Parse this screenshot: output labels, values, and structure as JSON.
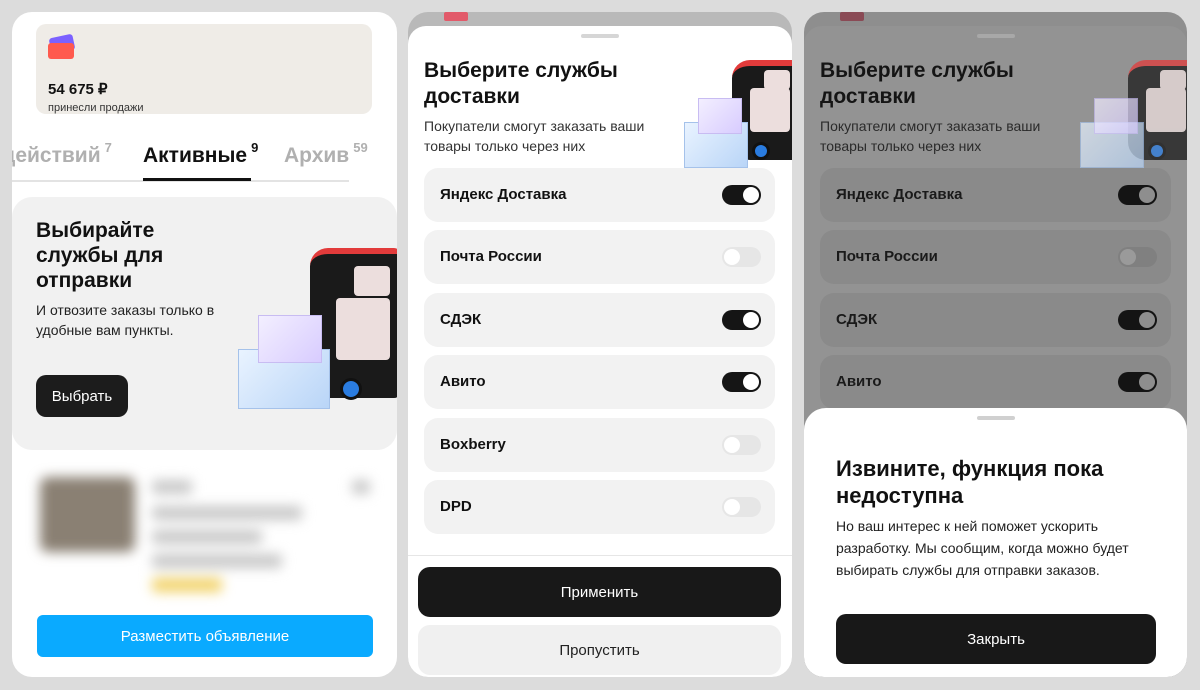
{
  "screen1": {
    "sales": {
      "amount": "54 675 ₽",
      "caption": "принесли продажи"
    },
    "tabs": [
      {
        "label": "действий",
        "count": "7"
      },
      {
        "label": "Активные",
        "count": "9"
      },
      {
        "label": "Архив",
        "count": "59"
      }
    ],
    "promo": {
      "title": "Выбирайте службы для отправки",
      "text": "И отвозите заказы только в удобные вам пункты.",
      "button": "Выбрать"
    },
    "post_button": "Разместить объявление"
  },
  "screen2": {
    "title": "Выберите службы доставки",
    "subtitle": "Покупатели смогут заказать ваши товары только через них",
    "services": [
      {
        "name": "Яндекс Доставка",
        "enabled": true
      },
      {
        "name": "Почта России",
        "enabled": false
      },
      {
        "name": "СДЭК",
        "enabled": true
      },
      {
        "name": "Авито",
        "enabled": true
      },
      {
        "name": "Boxberry",
        "enabled": false
      },
      {
        "name": "DPD",
        "enabled": false
      }
    ],
    "apply_button": "Применить",
    "skip_button": "Пропустить"
  },
  "screen3": {
    "title": "Выберите службы доставки",
    "subtitle": "Покупатели смогут заказать ваши товары только через них",
    "services": [
      {
        "name": "Яндекс Доставка",
        "enabled": true
      },
      {
        "name": "Почта России",
        "enabled": false
      },
      {
        "name": "СДЭК",
        "enabled": true
      },
      {
        "name": "Авито",
        "enabled": true
      }
    ],
    "modal": {
      "title": "Извините, функция пока недоступна",
      "text": "Но ваш интерес к ней поможет ускорить разработку. Мы сообщим, когда можно будет выбирать службы для отправки заказов.",
      "close_button": "Закрыть"
    }
  },
  "colors": {
    "accent_blue": "#0aaaff",
    "dark_button": "#181818",
    "toggle_on": "#151515"
  }
}
